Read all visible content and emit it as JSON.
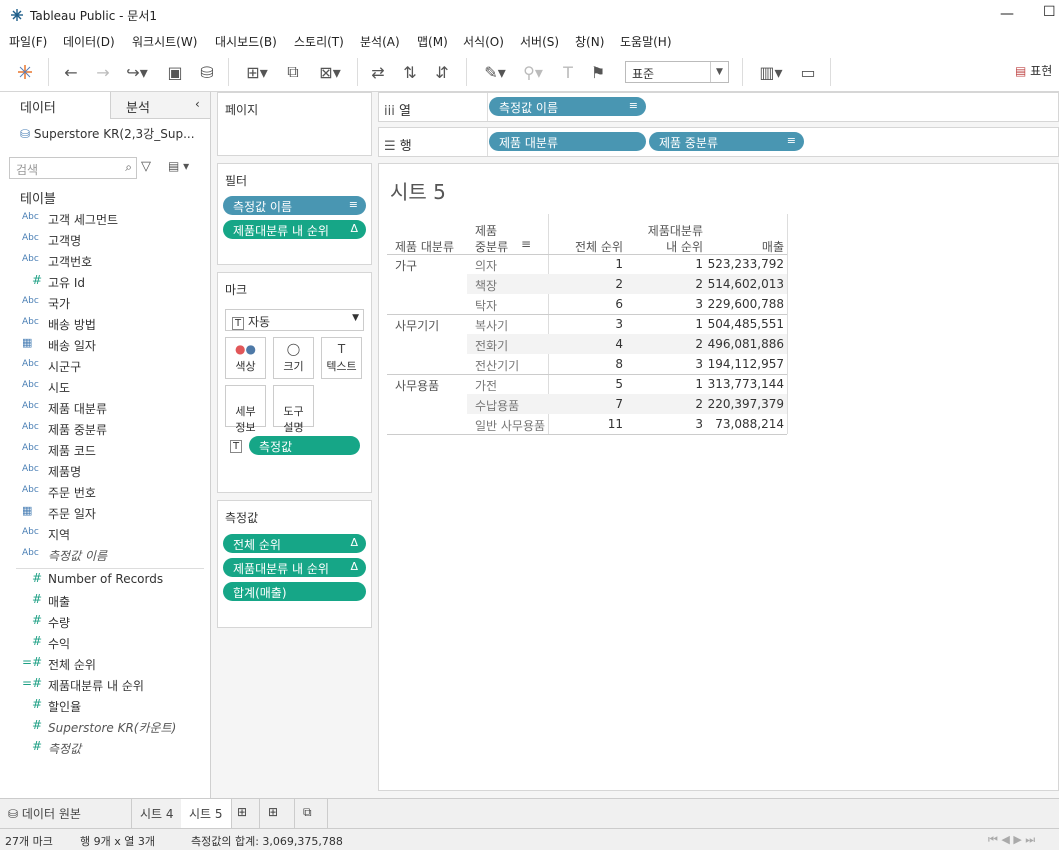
{
  "window": {
    "title": "Tableau Public - 문서1"
  },
  "menu": [
    "파일(F)",
    "데이터(D)",
    "워크시트(W)",
    "대시보드(B)",
    "스토리(T)",
    "분석(A)",
    "맵(M)",
    "서식(O)",
    "서버(S)",
    "창(N)",
    "도움말(H)"
  ],
  "toolbar": {
    "fit": "표준",
    "show_me": "표현"
  },
  "datapane": {
    "tab_data": "데이터",
    "tab_analysis": "분석",
    "source": "Superstore KR(2,3강_Sup...",
    "search_placeholder": "검색",
    "tables_header": "테이블",
    "dimensions": [
      {
        "icon": "Abc",
        "label": "고객 세그먼트"
      },
      {
        "icon": "Abc",
        "label": "고객명"
      },
      {
        "icon": "Abc",
        "label": "고객번호"
      },
      {
        "icon": "#",
        "label": "고유 Id"
      },
      {
        "icon": "Abc",
        "label": "국가"
      },
      {
        "icon": "Abc",
        "label": "배송 방법"
      },
      {
        "icon": "date",
        "label": "배송 일자"
      },
      {
        "icon": "Abc",
        "label": "시군구"
      },
      {
        "icon": "Abc",
        "label": "시도"
      },
      {
        "icon": "Abc",
        "label": "제품 대분류"
      },
      {
        "icon": "Abc",
        "label": "제품 중분류"
      },
      {
        "icon": "Abc",
        "label": "제품 코드"
      },
      {
        "icon": "Abc",
        "label": "제품명"
      },
      {
        "icon": "Abc",
        "label": "주문 번호"
      },
      {
        "icon": "date",
        "label": "주문 일자"
      },
      {
        "icon": "Abc",
        "label": "지역"
      },
      {
        "icon": "Abc",
        "label": "측정값 이름",
        "italic": true
      }
    ],
    "measures": [
      {
        "icon": "#",
        "label": "Number of Records"
      },
      {
        "icon": "#",
        "label": "매출"
      },
      {
        "icon": "#",
        "label": "수량"
      },
      {
        "icon": "#",
        "label": "수익"
      },
      {
        "icon": "=#",
        "label": "전체 순위"
      },
      {
        "icon": "=#",
        "label": "제품대분류 내 순위"
      },
      {
        "icon": "#",
        "label": "할인율"
      },
      {
        "icon": "#",
        "label": "Superstore KR(카운트)",
        "italic": true
      },
      {
        "icon": "#",
        "label": "측정값",
        "italic": true
      }
    ]
  },
  "cards": {
    "pages": "페이지",
    "filters": {
      "title": "필터",
      "items": [
        "측정값 이름",
        "제품대분류 내 순위"
      ]
    },
    "marks": {
      "title": "마크",
      "type": "자동",
      "color": "색상",
      "size": "크기",
      "text": "텍스트",
      "detail": "세부\n정보",
      "tooltip": "도구\n설명",
      "pill": "측정값"
    },
    "measure_values": {
      "title": "측정값",
      "items": [
        "전체 순위",
        "제품대분류 내 순위",
        "합계(매출)"
      ]
    }
  },
  "shelves": {
    "columns_label": "열",
    "rows_label": "행",
    "columns": [
      "측정값 이름"
    ],
    "rows": [
      "제품 대분류",
      "제품 중분류"
    ]
  },
  "sheet": {
    "title": "시트 5",
    "headers": {
      "category": "제품 대분류",
      "subcategory_1": "제품",
      "subcategory_2": "중분류",
      "overall_rank": "전체 순위",
      "in_cat_rank_1": "제품대분류",
      "in_cat_rank_2": "내 순위",
      "sales": "매출"
    },
    "groups": [
      {
        "category": "가구",
        "rows": [
          {
            "sub": "의자",
            "overall": "1",
            "rank": "1",
            "sales": "523,233,792"
          },
          {
            "sub": "책장",
            "overall": "2",
            "rank": "2",
            "sales": "514,602,013"
          },
          {
            "sub": "탁자",
            "overall": "6",
            "rank": "3",
            "sales": "229,600,788"
          }
        ]
      },
      {
        "category": "사무기기",
        "rows": [
          {
            "sub": "복사기",
            "overall": "3",
            "rank": "1",
            "sales": "504,485,551"
          },
          {
            "sub": "전화기",
            "overall": "4",
            "rank": "2",
            "sales": "496,081,886"
          },
          {
            "sub": "전산기기",
            "overall": "8",
            "rank": "3",
            "sales": "194,112,957"
          }
        ]
      },
      {
        "category": "사무용품",
        "rows": [
          {
            "sub": "가전",
            "overall": "5",
            "rank": "1",
            "sales": "313,773,144"
          },
          {
            "sub": "수납용품",
            "overall": "7",
            "rank": "2",
            "sales": "220,397,379"
          },
          {
            "sub": "일반 사무용품",
            "overall": "11",
            "rank": "3",
            "sales": "73,088,214"
          }
        ]
      }
    ]
  },
  "tabs": {
    "datasource": "데이터 원본",
    "sheets": [
      "시트 4",
      "시트 5"
    ],
    "active": "시트 5"
  },
  "status": {
    "marks": "27개 마크",
    "rows_cols": "행 9개  x  열 3개",
    "sum": "측정값의 합계: 3,069,375,788"
  }
}
